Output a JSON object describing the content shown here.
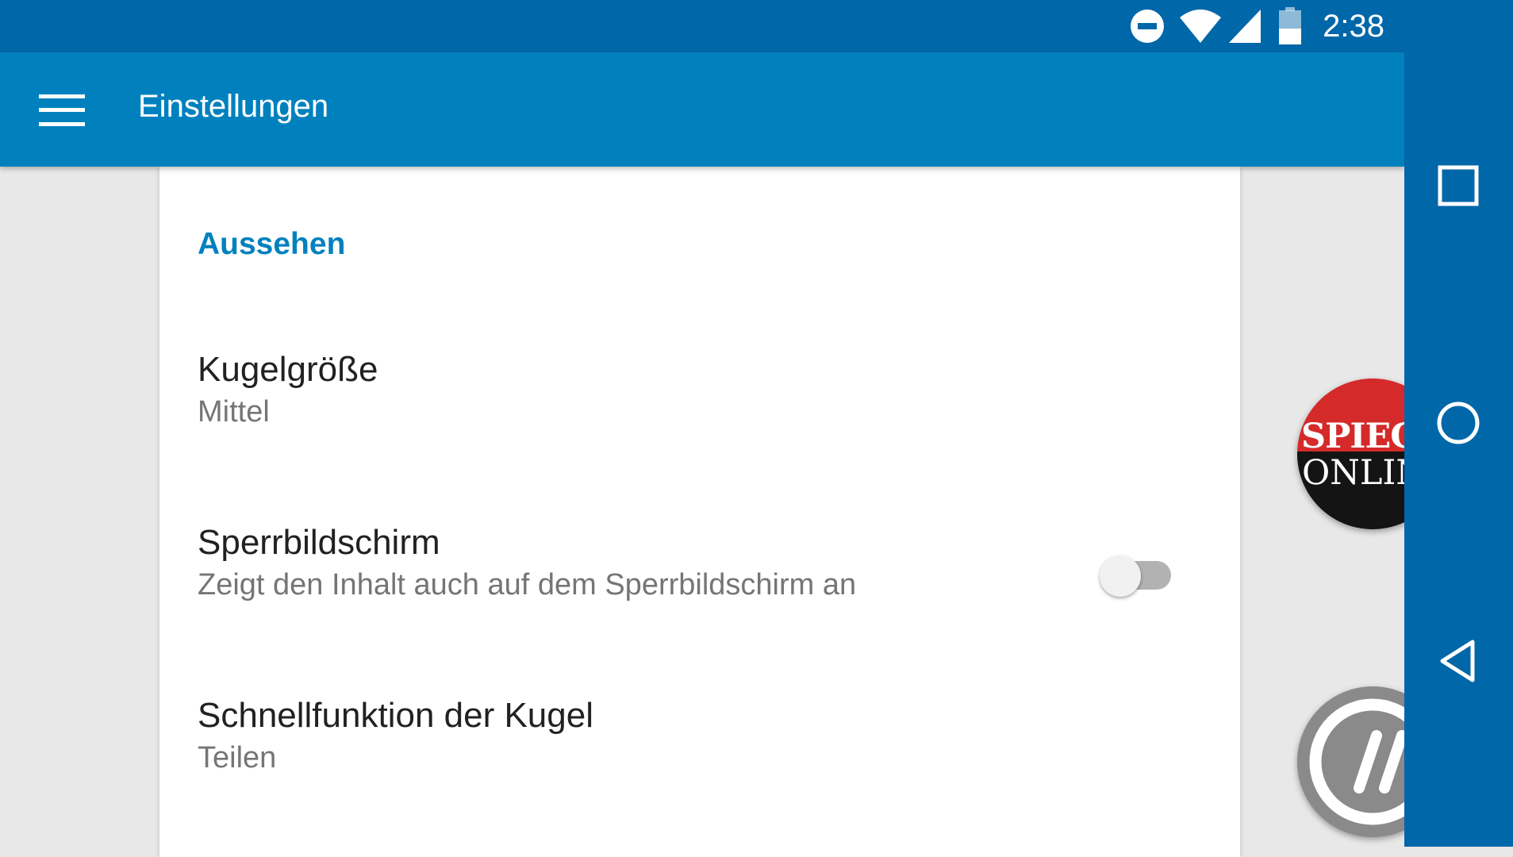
{
  "status_bar": {
    "time": "2:38",
    "icons": [
      "do-not-disturb-icon",
      "wifi-icon",
      "cell-signal-icon",
      "battery-icon"
    ]
  },
  "app_bar": {
    "title": "Einstellungen",
    "menu_icon": "hamburger-menu-icon"
  },
  "settings": {
    "section_header": "Aussehen",
    "items": [
      {
        "title": "Kugelgröße",
        "summary": "Mittel"
      },
      {
        "title": "Sperrbildschirm",
        "summary": "Zeigt den Inhalt auch auf dem Sperrbildschirm an",
        "toggle_on": false
      },
      {
        "title": "Schnellfunktion der Kugel",
        "summary": "Teilen"
      }
    ]
  },
  "bubbles": {
    "spiegel_line1": "SPIEGEL",
    "spiegel_line2": "ONLINE"
  },
  "nav_bar": {
    "icons": [
      "recents-square-icon",
      "home-circle-icon",
      "back-triangle-icon"
    ]
  },
  "colors": {
    "status_bar": "#0067a8",
    "app_bar": "#0081be",
    "accent": "#0081be",
    "background": "#e8e8e8",
    "card": "#ffffff"
  }
}
